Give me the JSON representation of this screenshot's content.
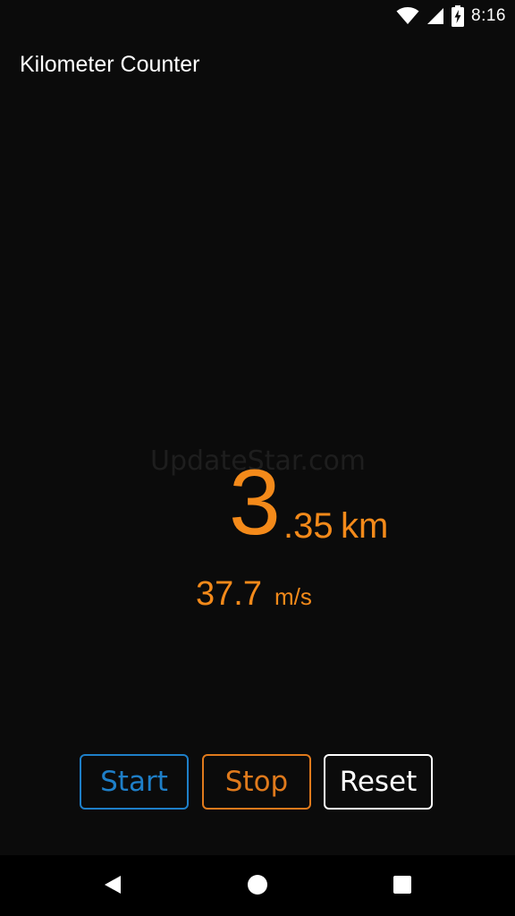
{
  "status_bar": {
    "time": "8:16",
    "icons": [
      "wifi-icon",
      "cell-signal-icon",
      "battery-charging-icon"
    ]
  },
  "app": {
    "title": "Kilometer Counter"
  },
  "watermark": "UpdateStar.com",
  "distance": {
    "integer": "3",
    "decimal": ".35",
    "unit": "km"
  },
  "speed": {
    "value": "37.7",
    "unit": "m/s"
  },
  "buttons": {
    "start_label": "Start",
    "stop_label": "Stop",
    "reset_label": "Reset"
  },
  "colors": {
    "accent_orange": "#f48a1a",
    "start_blue": "#1e7fc8",
    "stop_orange": "#e07a1c",
    "background": "#0b0b0b"
  },
  "nav_bar": {
    "icons": [
      "back-icon",
      "home-icon",
      "recents-icon"
    ]
  }
}
